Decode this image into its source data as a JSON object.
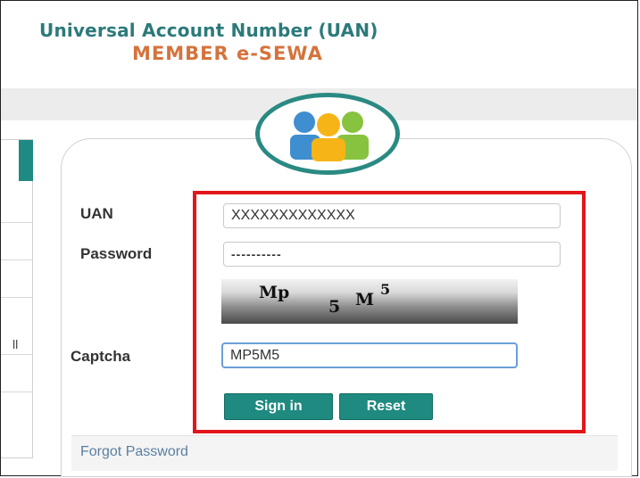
{
  "header": {
    "title": "Universal Account Number (UAN)",
    "subtitle": "MEMBER e-SEWA"
  },
  "left_panel": {
    "glyph": "ll"
  },
  "login": {
    "uan_label": "UAN",
    "uan_value": "XXXXXXXXXXXXX",
    "password_label": "Password",
    "password_value": "----------",
    "captcha_label": "Captcha",
    "captcha_image_text": "Mp 5 M5",
    "captcha_value": "MP5M5",
    "signin_label": "Sign in",
    "reset_label": "Reset",
    "forgot_label": "Forgot Password"
  },
  "icons": {
    "logo": "people-group-icon"
  },
  "colors": {
    "title": "#2c7a7b",
    "subtitle": "#d5733c",
    "button": "#1e8a80",
    "highlight_box": "#e2161a",
    "logo_ring": "#2a8a83"
  }
}
